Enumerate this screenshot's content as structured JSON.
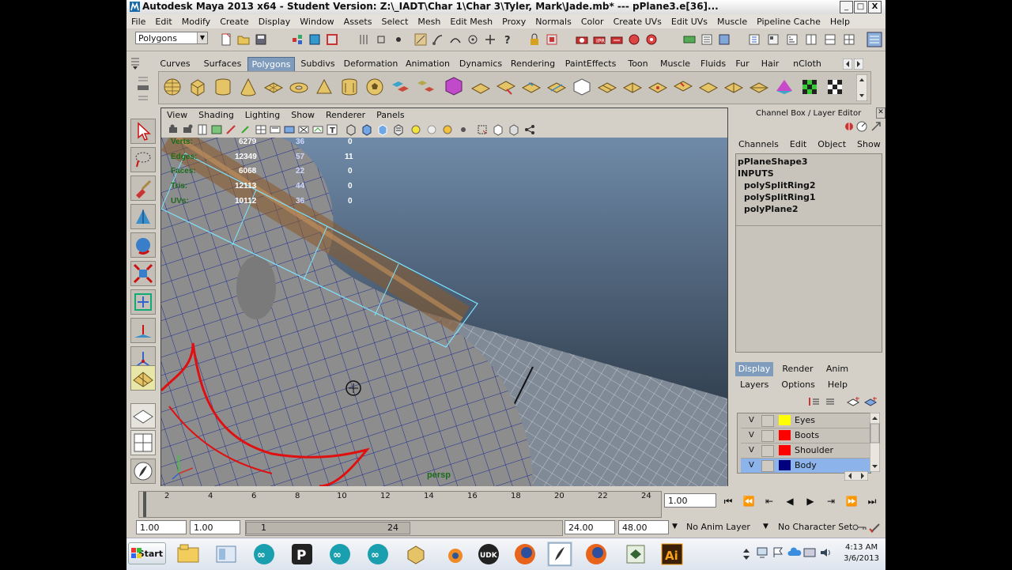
{
  "window": {
    "title": "Autodesk Maya 2013 x64 - Student Version: Z:\\_IADT\\Char 1\\Char 3\\Tyler, Mark\\Jade.mb*   ---   pPlane3.e[36]...",
    "min": "_",
    "max": "□",
    "close": "X"
  },
  "menubar": [
    "File",
    "Edit",
    "Modify",
    "Create",
    "Display",
    "Window",
    "Assets",
    "Select",
    "Mesh",
    "Edit Mesh",
    "Proxy",
    "Normals",
    "Color",
    "Create UVs",
    "Edit UVs",
    "Muscle",
    "Pipeline Cache",
    "Help"
  ],
  "statusline": {
    "mode": "Polygons"
  },
  "shelf": {
    "tabs": [
      "Curves",
      "Surfaces",
      "Polygons",
      "Subdivs",
      "Deformation",
      "Animation",
      "Dynamics",
      "Rendering",
      "PaintEffects",
      "Toon",
      "Muscle",
      "Fluids",
      "Fur",
      "Hair",
      "nCloth"
    ],
    "active_tab": "Polygons"
  },
  "viewport": {
    "menu": [
      "View",
      "Shading",
      "Lighting",
      "Show",
      "Renderer",
      "Panels"
    ],
    "camera_label": "persp",
    "hud": [
      {
        "label": "Verts:",
        "v1": "6279",
        "v2": "36",
        "v3": "0"
      },
      {
        "label": "Edges:",
        "v1": "12349",
        "v2": "57",
        "v3": "11"
      },
      {
        "label": "Faces:",
        "v1": "6068",
        "v2": "22",
        "v3": "0"
      },
      {
        "label": "Tris:",
        "v1": "12113",
        "v2": "44",
        "v3": "0"
      },
      {
        "label": "UVs:",
        "v1": "10112",
        "v2": "36",
        "v3": "0"
      }
    ]
  },
  "channelbox": {
    "title": "Channel Box / Layer Editor",
    "menu": [
      "Channels",
      "Edit",
      "Object",
      "Show"
    ],
    "object": "pPlaneShape3",
    "inputs_label": "INPUTS",
    "inputs": [
      "polySplitRing2",
      "polySplitRing1",
      "polyPlane2"
    ]
  },
  "layereditor": {
    "tabs": [
      "Display",
      "Render",
      "Anim"
    ],
    "active_tab": "Display",
    "menu": [
      "Layers",
      "Options",
      "Help"
    ],
    "layers": [
      {
        "v": "V",
        "name": "Eyes",
        "color": "#ffff00"
      },
      {
        "v": "V",
        "name": "Boots",
        "color": "#ff0000"
      },
      {
        "v": "V",
        "name": "Shoulder",
        "color": "#ff0000"
      },
      {
        "v": "V",
        "name": "Body",
        "color": "#00007f",
        "selected": true
      }
    ]
  },
  "timeslider": {
    "ticks": [
      "2",
      "4",
      "6",
      "8",
      "10",
      "12",
      "14",
      "16",
      "18",
      "20",
      "22",
      "24"
    ],
    "current_time": "1.00"
  },
  "rangeslider": {
    "start": "1.00",
    "playback_start": "1.00",
    "range_start": "1",
    "range_end": "24",
    "playback_end": "24.00",
    "end": "48.00",
    "anim_layer": "No Anim Layer",
    "character_set": "No Character Set"
  },
  "taskbar": {
    "start_label": "Start",
    "time": "4:13 AM",
    "date": "3/6/2013"
  }
}
